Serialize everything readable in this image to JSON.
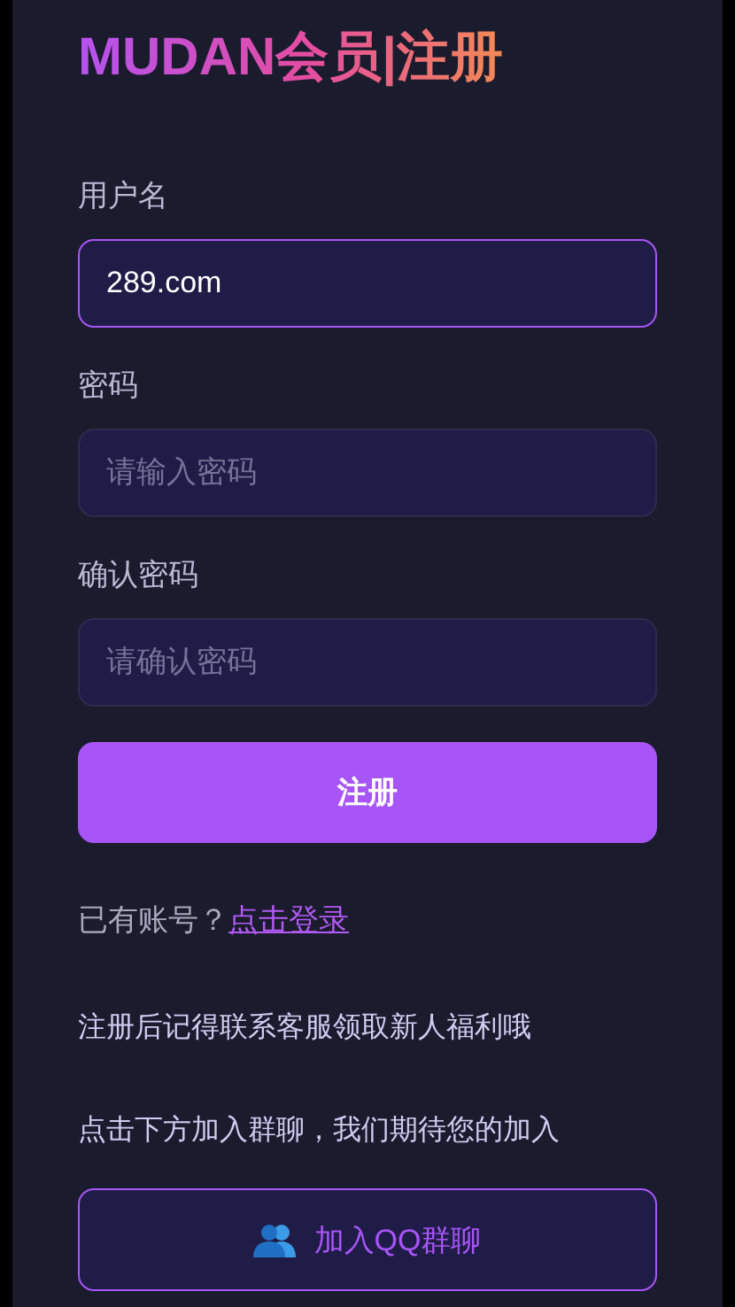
{
  "title": "MUDAN会员|注册",
  "fields": [
    {
      "label": "用户名",
      "value": "289.com",
      "focused": true
    },
    {
      "label": "密码",
      "placeholder": "请输入密码",
      "focused": false
    },
    {
      "label": "确认密码",
      "placeholder": "请确认密码",
      "focused": false
    }
  ],
  "submit_button": "注册",
  "login_prompt": {
    "text": "已有账号？",
    "link": "点击登录"
  },
  "notes": [
    "注册后记得联系客服领取新人福利哦",
    "点击下方加入群聊，我们期待您的加入"
  ],
  "group_button": "加入QQ群聊"
}
